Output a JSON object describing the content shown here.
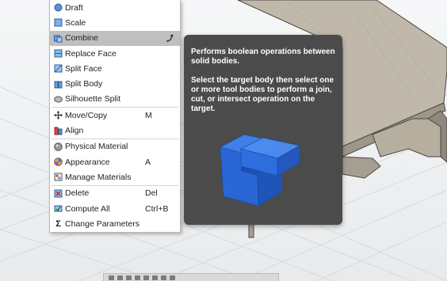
{
  "menu": {
    "items": [
      {
        "label": "Draft",
        "icon": "draft-icon",
        "shortcut": ""
      },
      {
        "label": "Scale",
        "icon": "scale-icon",
        "shortcut": ""
      },
      {
        "label": "Combine",
        "icon": "combine-icon",
        "shortcut": "",
        "highlighted": true
      },
      {
        "label": "Replace Face",
        "icon": "replace-face-icon",
        "shortcut": ""
      },
      {
        "label": "Split Face",
        "icon": "split-face-icon",
        "shortcut": ""
      },
      {
        "label": "Split Body",
        "icon": "split-body-icon",
        "shortcut": ""
      },
      {
        "label": "Silhouette Split",
        "icon": "silhouette-split-icon",
        "shortcut": ""
      },
      {
        "label": "Move/Copy",
        "icon": "move-icon",
        "shortcut": "M"
      },
      {
        "label": "Align",
        "icon": "align-icon",
        "shortcut": ""
      },
      {
        "label": "Physical Material",
        "icon": "physical-material-icon",
        "shortcut": ""
      },
      {
        "label": "Appearance",
        "icon": "appearance-icon",
        "shortcut": "A"
      },
      {
        "label": "Manage Materials",
        "icon": "manage-materials-icon",
        "shortcut": ""
      },
      {
        "label": "Delete",
        "icon": "delete-icon",
        "shortcut": "Del"
      },
      {
        "label": "Compute All",
        "icon": "compute-all-icon",
        "shortcut": "Ctrl+B"
      },
      {
        "label": "Change Parameters",
        "icon": "parameters-icon",
        "shortcut": ""
      }
    ]
  },
  "tooltip": {
    "line1": "Performs boolean operations between solid bodies.",
    "line2": "Select the target body then select one or more tool bodies to perform a join, cut, or intersect operation on the target."
  },
  "colors": {
    "highlight": "#bfbfbf",
    "tooltip_bg": "#4b4b4b",
    "body_blue": "#2a66d6",
    "model_fill": "#bfb8ab"
  }
}
